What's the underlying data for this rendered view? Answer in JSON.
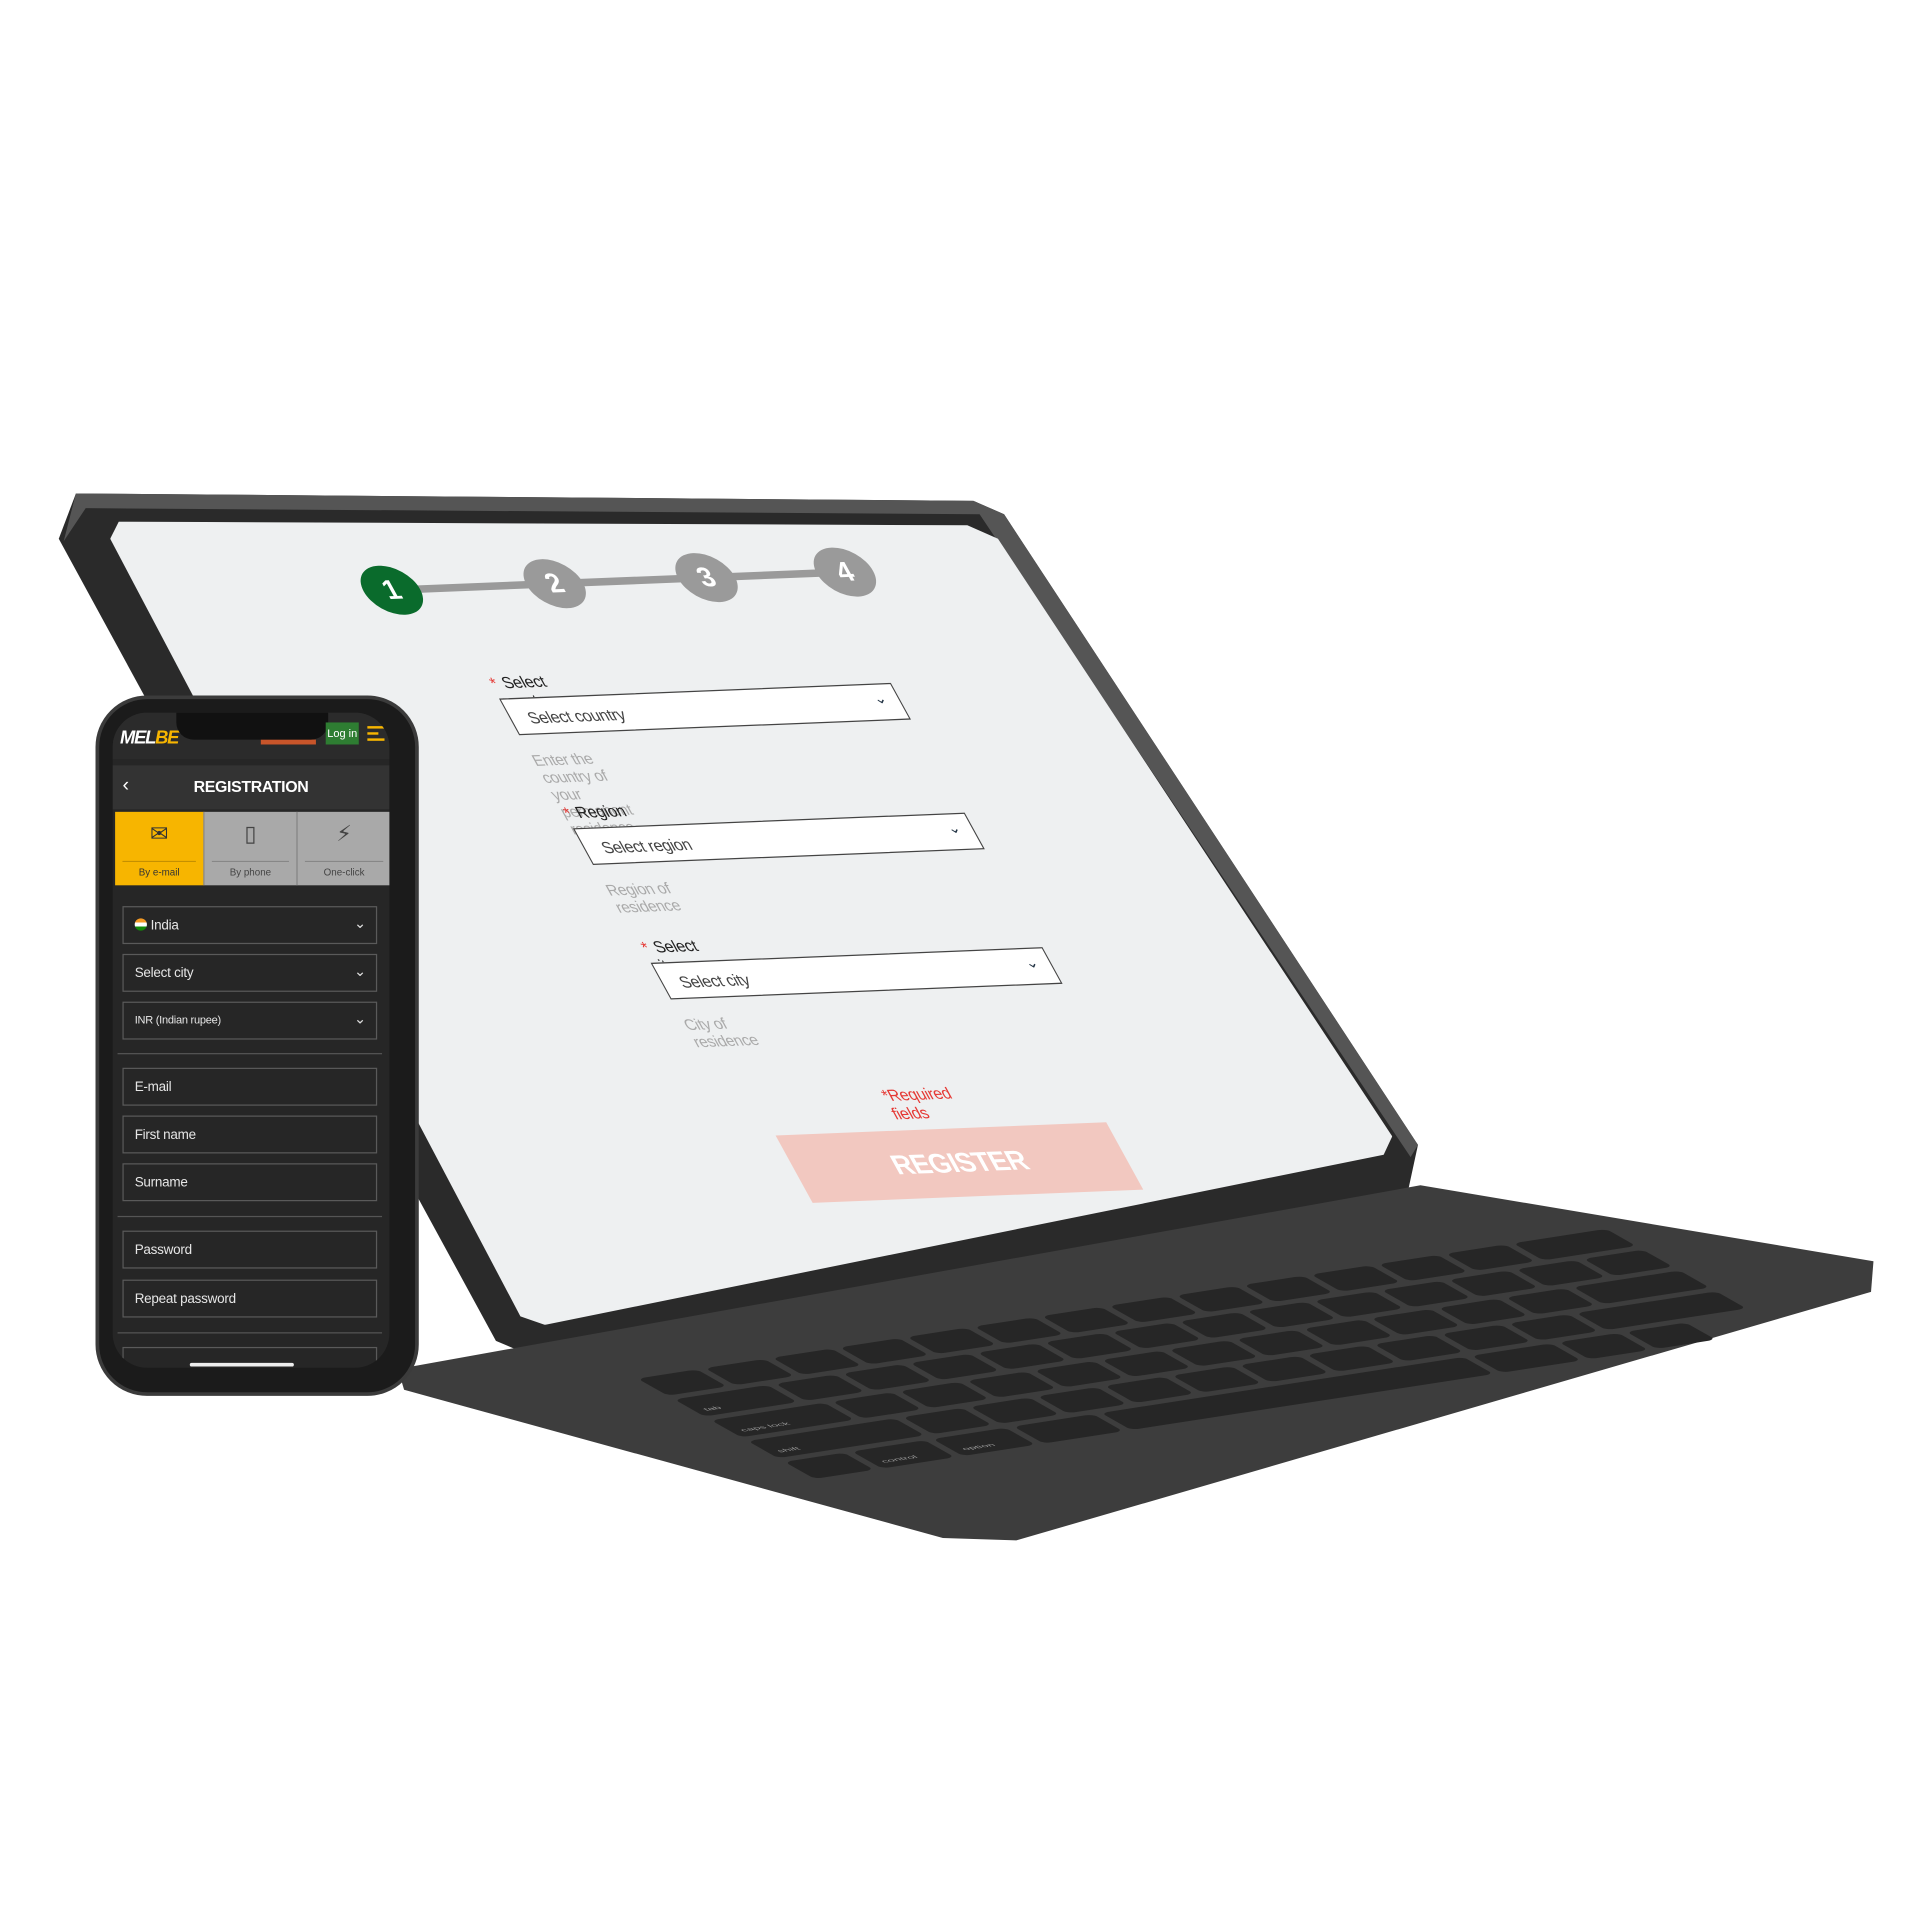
{
  "tablet": {
    "steps": [
      {
        "label": "1",
        "active": true
      },
      {
        "label": "2",
        "active": false
      },
      {
        "label": "3",
        "active": false
      },
      {
        "label": "4",
        "active": false
      }
    ],
    "fields": [
      {
        "label": "Select country",
        "placeholder": "Select country",
        "hint": "Enter the country of your permanent residence"
      },
      {
        "label": "Region",
        "placeholder": "Select region",
        "hint": "Region of residence"
      },
      {
        "label": "Select city",
        "placeholder": "Select city",
        "hint": "City of residence"
      }
    ],
    "required_marker": "*",
    "required_note": "*Required fields",
    "register_label": "REGISTER",
    "colors": {
      "active_step": "#0a6b2c",
      "inactive_step": "#9a9a9a",
      "register_disabled": "#f2c8c0",
      "required": "#e53935"
    }
  },
  "keyboard": {
    "labels": [
      "tab",
      "caps lock",
      "shift",
      "control",
      "option"
    ]
  },
  "phone": {
    "logo": {
      "main": "MEL",
      "accent": "BE"
    },
    "login_label": "Log in",
    "title": "REGISTRATION",
    "tabs": [
      {
        "label": "By e-mail",
        "icon": "envelope-icon",
        "active": true
      },
      {
        "label": "By phone",
        "icon": "phone-icon",
        "active": false
      },
      {
        "label": "One-click",
        "icon": "lightning-icon",
        "active": false
      }
    ],
    "selects": [
      "India",
      "Select city",
      "INR (Indian rupee)"
    ],
    "inputs": [
      "E-mail",
      "First name",
      "Surname"
    ],
    "password_inputs": [
      "Password",
      "Repeat password"
    ],
    "colors": {
      "accent": "#f7b500",
      "login": "#2e7d32"
    }
  }
}
